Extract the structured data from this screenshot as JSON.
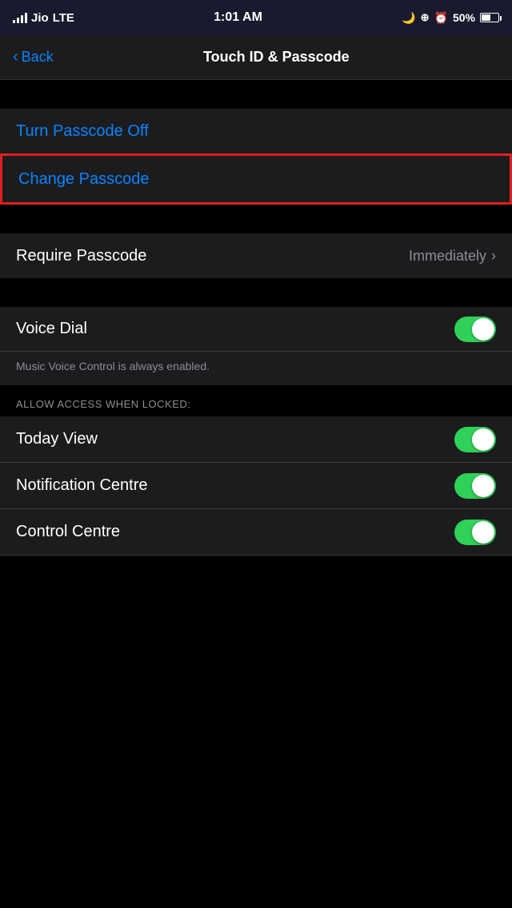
{
  "statusBar": {
    "carrier": "Jio",
    "network": "LTE",
    "time": "1:01 AM",
    "battery": "50%"
  },
  "navBar": {
    "backLabel": "Back",
    "title": "Touch ID & Passcode"
  },
  "menu": {
    "turnPasscodeOff": "Turn Passcode Off",
    "changePasscode": "Change Passcode",
    "requirePasscode": "Require Passcode",
    "requireValue": "Immediately",
    "voiceDial": "Voice Dial",
    "musicNote": "Music Voice Control is always enabled.",
    "allowAccessHeader": "ALLOW ACCESS WHEN LOCKED:",
    "todayView": "Today View",
    "notificationCentre": "Notification Centre",
    "controlCentre": "Control Centre"
  }
}
